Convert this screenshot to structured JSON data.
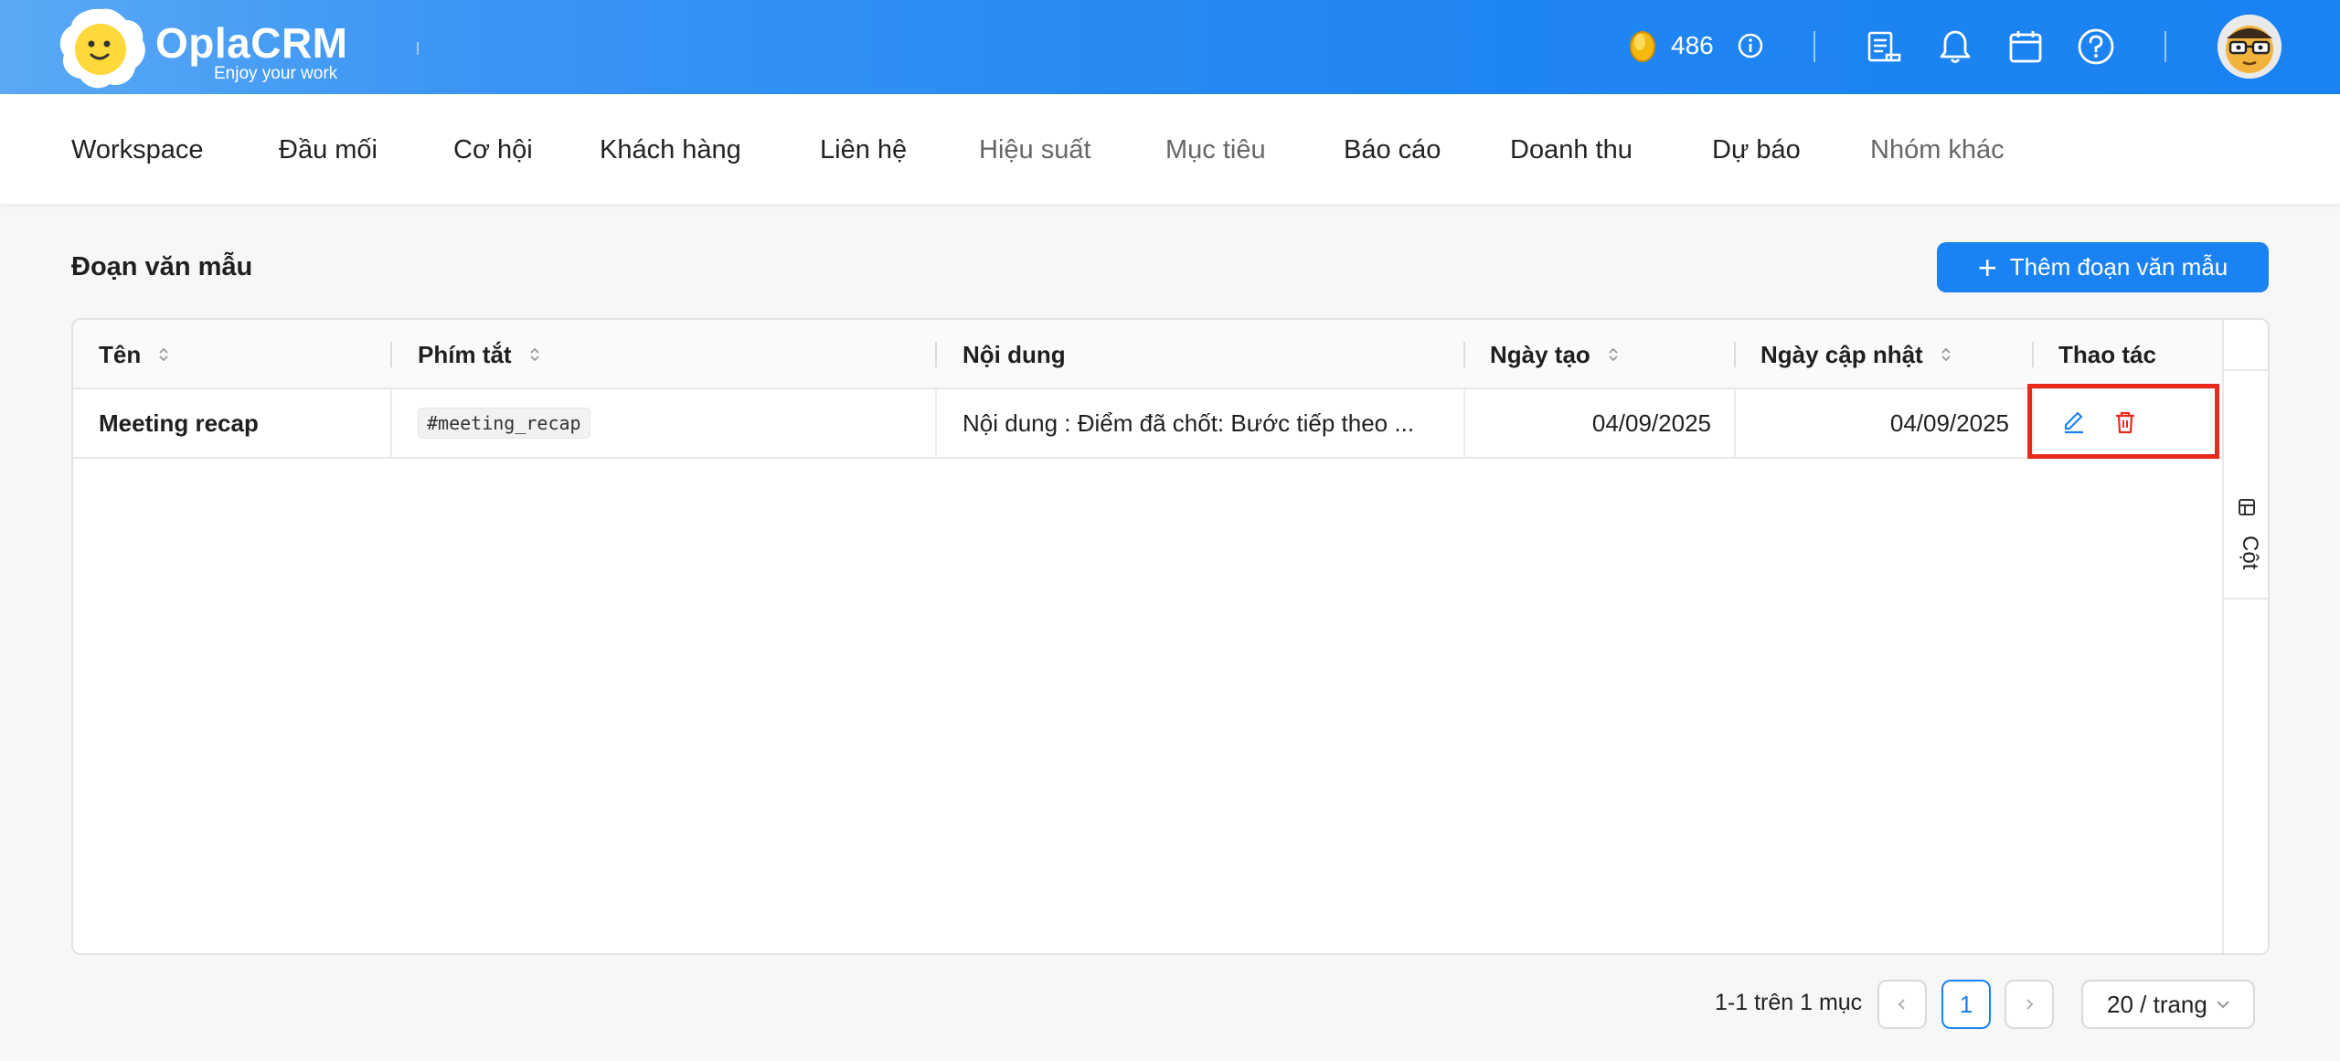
{
  "header": {
    "brand": "OplaCRM",
    "tagline": "Enjoy your work",
    "coin_count": "486",
    "icons": [
      "coin-icon",
      "info-icon",
      "task-list-icon",
      "bell-icon",
      "calendar-icon",
      "help-icon",
      "avatar"
    ]
  },
  "nav": {
    "items": [
      "Workspace",
      "Đầu mối",
      "Cơ hội",
      "Khách hàng",
      "Liên hệ",
      "Hiệu suất",
      "Mục tiêu",
      "Báo cáo",
      "Doanh thu",
      "Dự báo",
      "Nhóm khác"
    ]
  },
  "page": {
    "title": "Đoạn văn mẫu",
    "add_button": "Thêm đoạn văn mẫu"
  },
  "table": {
    "columns": [
      "Tên",
      "Phím tắt",
      "Nội dung",
      "Ngày tạo",
      "Ngày cập nhật",
      "Thao tác"
    ],
    "rows": [
      {
        "name": "Meeting recap",
        "shortcut": "#meeting_recap",
        "content": "Nội dung : Điểm đã chốt: Bước tiếp theo ...",
        "created": "04/09/2025",
        "updated": "04/09/2025"
      }
    ],
    "side_label": "Cột"
  },
  "pagination": {
    "info": "1-1 trên 1 mục",
    "current_page": "1",
    "page_size": "20 / trang"
  },
  "colors": {
    "primary": "#1a82f2",
    "delete": "#e8291c",
    "highlight_box": "#e8291c"
  }
}
